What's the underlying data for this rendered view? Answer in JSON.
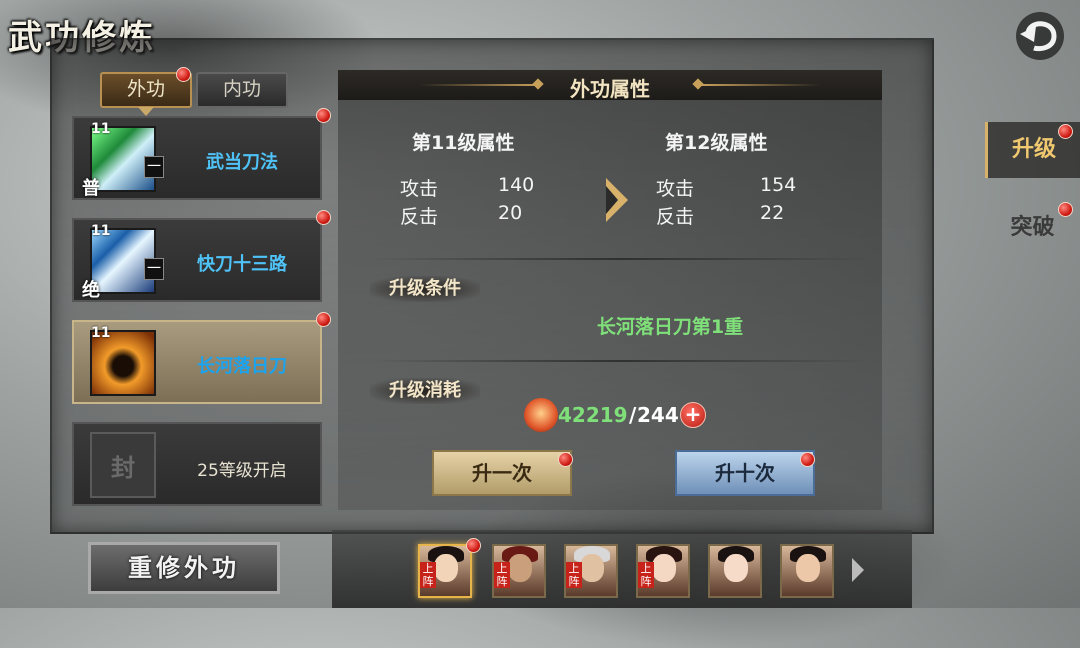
{
  "title": "武功修炼",
  "tabs": [
    {
      "label": "外功",
      "active": true
    },
    {
      "label": "内功",
      "active": false
    }
  ],
  "skills": [
    {
      "level": "11",
      "name": "武当刀法",
      "grade": "普",
      "mark": "一",
      "icon": "green-blade-icon"
    },
    {
      "level": "11",
      "name": "快刀十三路",
      "grade": "绝",
      "mark": "一",
      "icon": "blue-blade-icon"
    },
    {
      "level": "11",
      "name": "长河落日刀",
      "grade": "",
      "mark": "",
      "icon": "fire-swordsman-icon",
      "selected": true
    },
    {
      "level": "",
      "name": "25等级开启",
      "lock_text": "封",
      "icon": "lock-icon"
    }
  ],
  "rebuild_label": "重修外功",
  "detail": {
    "title": "外功属性",
    "current_header": "第11级属性",
    "next_header": "第12级属性",
    "current_stats": [
      {
        "label": "攻击",
        "value": "140"
      },
      {
        "label": "反击",
        "value": "20"
      }
    ],
    "next_stats": [
      {
        "label": "攻击",
        "value": "154"
      },
      {
        "label": "反击",
        "value": "22"
      }
    ],
    "condition_label": "升级条件",
    "condition_text": "长河落日刀第1重",
    "cost_label": "升级消耗",
    "cost_current": "42219",
    "cost_separator": "/",
    "cost_required": "244",
    "upgrade_once": "升一次",
    "upgrade_ten": "升十次"
  },
  "side_tabs": {
    "upgrade": "升级",
    "breakthrough": "突破"
  },
  "heroes": [
    {
      "name": "hero-1",
      "tag": "上阵",
      "active": true
    },
    {
      "name": "hero-2",
      "tag": "上阵"
    },
    {
      "name": "hero-3",
      "tag": "上阵"
    },
    {
      "name": "hero-4",
      "tag": "上阵"
    },
    {
      "name": "hero-5",
      "tag": ""
    },
    {
      "name": "hero-6",
      "tag": ""
    }
  ],
  "colors": {
    "accent_gold": "#d8b26a",
    "skill_name_blue": "#4fc3f7",
    "condition_green": "#7fe07a",
    "notification_red": "#d01e16"
  }
}
